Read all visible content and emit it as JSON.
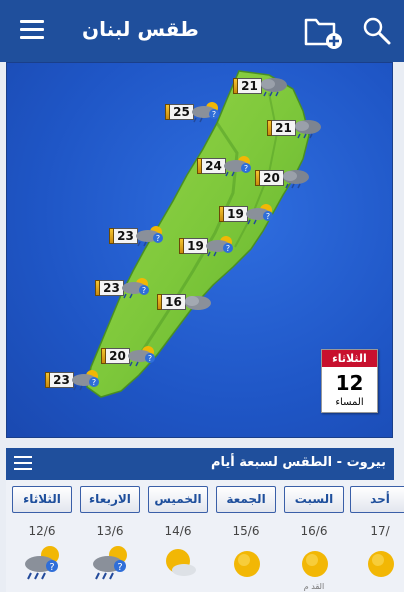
{
  "app": {
    "title": "طقس لبنان",
    "colors": {
      "primary": "#1f4f9c",
      "sea": "#1e56c8",
      "land": "#7ec83b",
      "accent_red": "#c8102e"
    }
  },
  "toolbar": {
    "menu_icon": "hamburger-menu-icon",
    "folder_icon": "folder-add-icon",
    "search_icon": "search-icon"
  },
  "map": {
    "markers": [
      {
        "id": "m1",
        "temp": "21",
        "icon": "cloud-rain-icon"
      },
      {
        "id": "m2",
        "temp": "25",
        "icon": "sun-cloud-rain-icon"
      },
      {
        "id": "m3",
        "temp": "21",
        "icon": "cloud-rain-icon"
      },
      {
        "id": "m4",
        "temp": "24",
        "icon": "sun-cloud-rain-icon"
      },
      {
        "id": "m5",
        "temp": "20",
        "icon": "cloud-rain-icon"
      },
      {
        "id": "m6",
        "temp": "19",
        "icon": "sun-cloud-rain-icon"
      },
      {
        "id": "m7",
        "temp": "23",
        "icon": "sun-cloud-rain-icon"
      },
      {
        "id": "m8",
        "temp": "19",
        "icon": "sun-cloud-rain-icon"
      },
      {
        "id": "m9",
        "temp": "23",
        "icon": "sun-cloud-rain-icon"
      },
      {
        "id": "m10",
        "temp": "16",
        "icon": "cloud-icon"
      },
      {
        "id": "m11",
        "temp": "20",
        "icon": "sun-cloud-rain-icon"
      },
      {
        "id": "m12",
        "temp": "23",
        "icon": "sun-cloud-rain-icon"
      }
    ],
    "date_badge": {
      "day": "الثلاثاء",
      "date": "12",
      "period": "المساء"
    }
  },
  "forecast": {
    "title": "بيروت - الطقس لسبعة أيام",
    "days": [
      {
        "name": "الثلاثاء",
        "date": "12/6",
        "icon": "sun-cloud-rain-icon",
        "sub": ""
      },
      {
        "name": "الاربعاء",
        "date": "13/6",
        "icon": "sun-cloud-rain-icon",
        "sub": ""
      },
      {
        "name": "الخميس",
        "date": "14/6",
        "icon": "sun-cloud-icon",
        "sub": ""
      },
      {
        "name": "الجمعة",
        "date": "15/6",
        "icon": "sun-icon",
        "sub": ""
      },
      {
        "name": "السبت",
        "date": "16/6",
        "icon": "sun-icon",
        "sub": "القد م"
      },
      {
        "name": "أحد",
        "date": "17/",
        "icon": "sun-icon",
        "sub": ""
      }
    ]
  }
}
